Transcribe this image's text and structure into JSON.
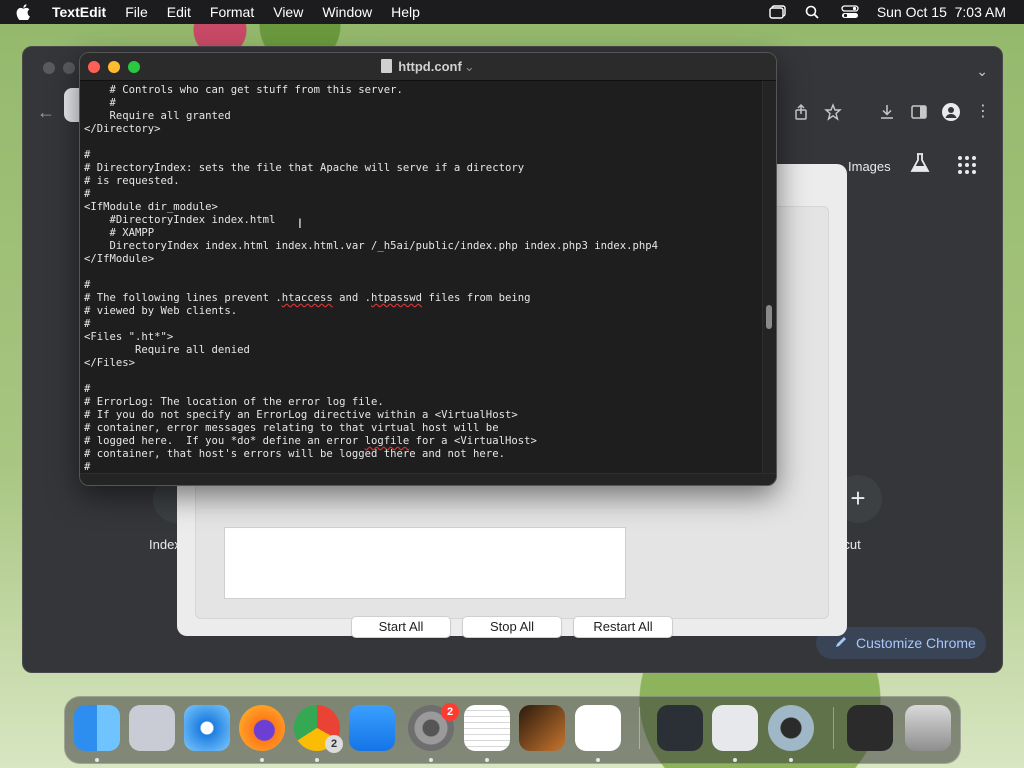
{
  "menubar": {
    "apple": "apple-icon",
    "app_name": "TextEdit",
    "items": [
      "File",
      "Edit",
      "Format",
      "View",
      "Window",
      "Help"
    ],
    "clock": "Sun Oct 15  7:03 AM"
  },
  "chrome": {
    "images_link": "Images",
    "shortcut_left_label": "Index",
    "shortcut_right_label": "hortcut",
    "customize_label": "Customize Chrome"
  },
  "xampp": {
    "buttons": [
      "Start All",
      "Stop All",
      "Restart All"
    ]
  },
  "textedit": {
    "title": "httpd.conf",
    "lines": [
      "    # Controls who can get stuff from this server.",
      "    #",
      "    Require all granted",
      "</Directory>",
      "",
      "#",
      "# DirectoryIndex: sets the file that Apache will serve if a directory",
      "# is requested.",
      "#",
      "<IfModule dir_module>",
      "    #DirectoryIndex index.html",
      "    # XAMPP",
      "    DirectoryIndex index.html index.html.var /_h5ai/public/index.php index.php3 index.php4",
      "</IfModule>",
      "",
      "#",
      "# The following lines prevent .htaccess and .htpasswd files from being",
      "# viewed by Web clients.",
      "#",
      "<Files \".ht*\">",
      "        Require all denied",
      "</Files>",
      "",
      "#",
      "# ErrorLog: The location of the error log file.",
      "# If you do not specify an ErrorLog directive within a <VirtualHost>",
      "# container, error messages relating to that virtual host will be",
      "# logged here.  If you *do* define an error logfile for a <VirtualHost>",
      "# container, that host's errors will be logged there and not here.",
      "#"
    ]
  },
  "dock": {
    "apps": [
      "finder-icon",
      "launchpad-icon",
      "safari-icon",
      "firefox-icon",
      "chrome-icon",
      "app-store-icon",
      "system-settings-icon",
      "textedit-icon",
      "garageband-icon",
      "vscode-icon",
      "nox-icon",
      "xampp-icon",
      "quicktime-icon",
      "downloads-stack-icon",
      "trash-icon"
    ],
    "settings_badge": "2",
    "chrome_badge": "2"
  }
}
